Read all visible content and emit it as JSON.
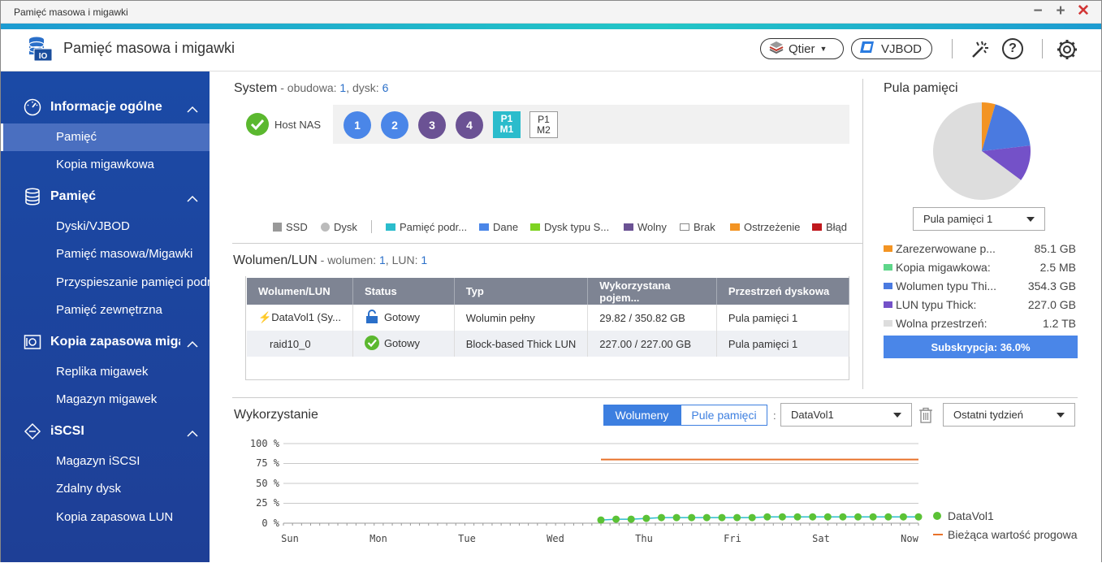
{
  "window": {
    "title": "Pamięć masowa i migawki"
  },
  "app": {
    "name": "Pamięć masowa i migawki",
    "qtier_label": "Qtier",
    "vjbod_label": "VJBOD"
  },
  "sidebar": {
    "sections": [
      {
        "label": "Informacje ogólne",
        "icon": "dashboard-gauge-icon",
        "items": [
          "Pamięć",
          "Kopia migawkowa"
        ]
      },
      {
        "label": "Pamięć",
        "icon": "storage-database-icon",
        "items": [
          "Dyski/VJBOD",
          "Pamięć masowa/Migawki",
          "Przyspieszanie pamięci podręcznej",
          "Pamięć zewnętrzna"
        ]
      },
      {
        "label": "Kopia zapasowa migawek",
        "icon": "snapshot-backup-icon",
        "items": [
          "Replika migawek",
          "Magazyn migawek"
        ]
      },
      {
        "label": "iSCSI",
        "icon": "iscsi-icon",
        "items": [
          "Magazyn iSCSI",
          "Zdalny dysk",
          "Kopia zapasowa LUN"
        ]
      }
    ],
    "active_item": "Pamięć"
  },
  "system": {
    "title": "System",
    "sub_prefix": " - obudowa: ",
    "enclosure_count": "1",
    "disk_prefix": ", dysk: ",
    "disk_count": "6",
    "host_label": "Host NAS",
    "disks": [
      "1",
      "2",
      "3",
      "4"
    ],
    "ports": [
      {
        "l1": "P1",
        "l2": "M1"
      },
      {
        "l1": "P1",
        "l2": "M2"
      }
    ],
    "legend": [
      "SSD",
      "Dysk",
      "Pamięć podr...",
      "Dane",
      "Dysk typu S...",
      "Wolny",
      "Brak",
      "Ostrzeżenie",
      "Błąd"
    ],
    "legend_colors": [
      "#999999",
      "#bbbbbb",
      "#2bbccc",
      "#4a86e8",
      "#7ed321",
      "#6b5294",
      "#ffffff",
      "#f39423",
      "#c0181d"
    ]
  },
  "volumes": {
    "title": "Wolumen/LUN",
    "sub_prefix": " - wolumen: ",
    "volume_count": "1",
    "lun_prefix": ", LUN: ",
    "lun_count": "1",
    "headers": [
      "Wolumen/LUN",
      "Status",
      "Typ",
      "Wykorzystana pojem...",
      "Przestrzeń dyskowa"
    ],
    "rows": [
      {
        "name": "DataVol1 (Sy...",
        "status": "Gotowy",
        "type": "Wolumin pełny",
        "used": "29.82 / 350.82 GB",
        "pool": "Pula pamięci 1"
      },
      {
        "name": "raid10_0",
        "status": "Gotowy",
        "type": "Block-based Thick LUN",
        "used": "227.00 / 227.00 GB",
        "pool": "Pula pamięci 1"
      }
    ]
  },
  "pool": {
    "title": "Pula pamięci",
    "selector": "Pula pamięci 1",
    "items": [
      {
        "label": "Zarezerwowane p...",
        "value": "85.1 GB",
        "color": "#f39423",
        "gb": 85.1
      },
      {
        "label": "Kopia migawkowa:",
        "value": "2.5 MB",
        "color": "#5ed68a",
        "gb": 0.0025
      },
      {
        "label": "Wolumen typu Thi...",
        "value": "354.3 GB",
        "color": "#4a7ae0",
        "gb": 354.3
      },
      {
        "label": "LUN typu Thick:",
        "value": "227.0 GB",
        "color": "#7451c8",
        "gb": 227.0
      },
      {
        "label": "Wolna przestrzeń:",
        "value": "1.2 TB",
        "color": "#dddddd",
        "gb": 1228.8
      }
    ],
    "subscription_label": "Subskrypcja: 36.0%"
  },
  "usage": {
    "title": "Wykorzystanie",
    "tab_volumes": "Wolumeny",
    "tab_pools": "Pule pamięci",
    "separator": ":",
    "volume_select": "DataVol1",
    "period_select": "Ostatni tydzień",
    "legend_series": "DataVol1",
    "legend_threshold": "Bieżąca wartość progowa"
  },
  "chart_data": {
    "type": "line",
    "x_ticks": [
      "Sun",
      "Mon",
      "Tue",
      "Wed",
      "Thu",
      "Fri",
      "Sat",
      "Now"
    ],
    "y_ticks": [
      "100 %",
      "75 %",
      "50 %",
      "25 %",
      "0 %"
    ],
    "ylim": [
      0,
      100
    ],
    "grid": true,
    "legend_position": "right",
    "series": [
      {
        "name": "DataVol1",
        "color": "#5bc236",
        "x_start_day": 3.5,
        "x_end_day": 7.0,
        "values": [
          4,
          5,
          5,
          6,
          7,
          7,
          7,
          7,
          7,
          7,
          7,
          8,
          8,
          8,
          8,
          8,
          8,
          8,
          8,
          8,
          8,
          8
        ]
      },
      {
        "name": "Bieżąca wartość progowa",
        "color": "#e8722a",
        "x_start_day": 3.5,
        "x_end_day": 7.0,
        "values": [
          80,
          80
        ]
      }
    ]
  }
}
